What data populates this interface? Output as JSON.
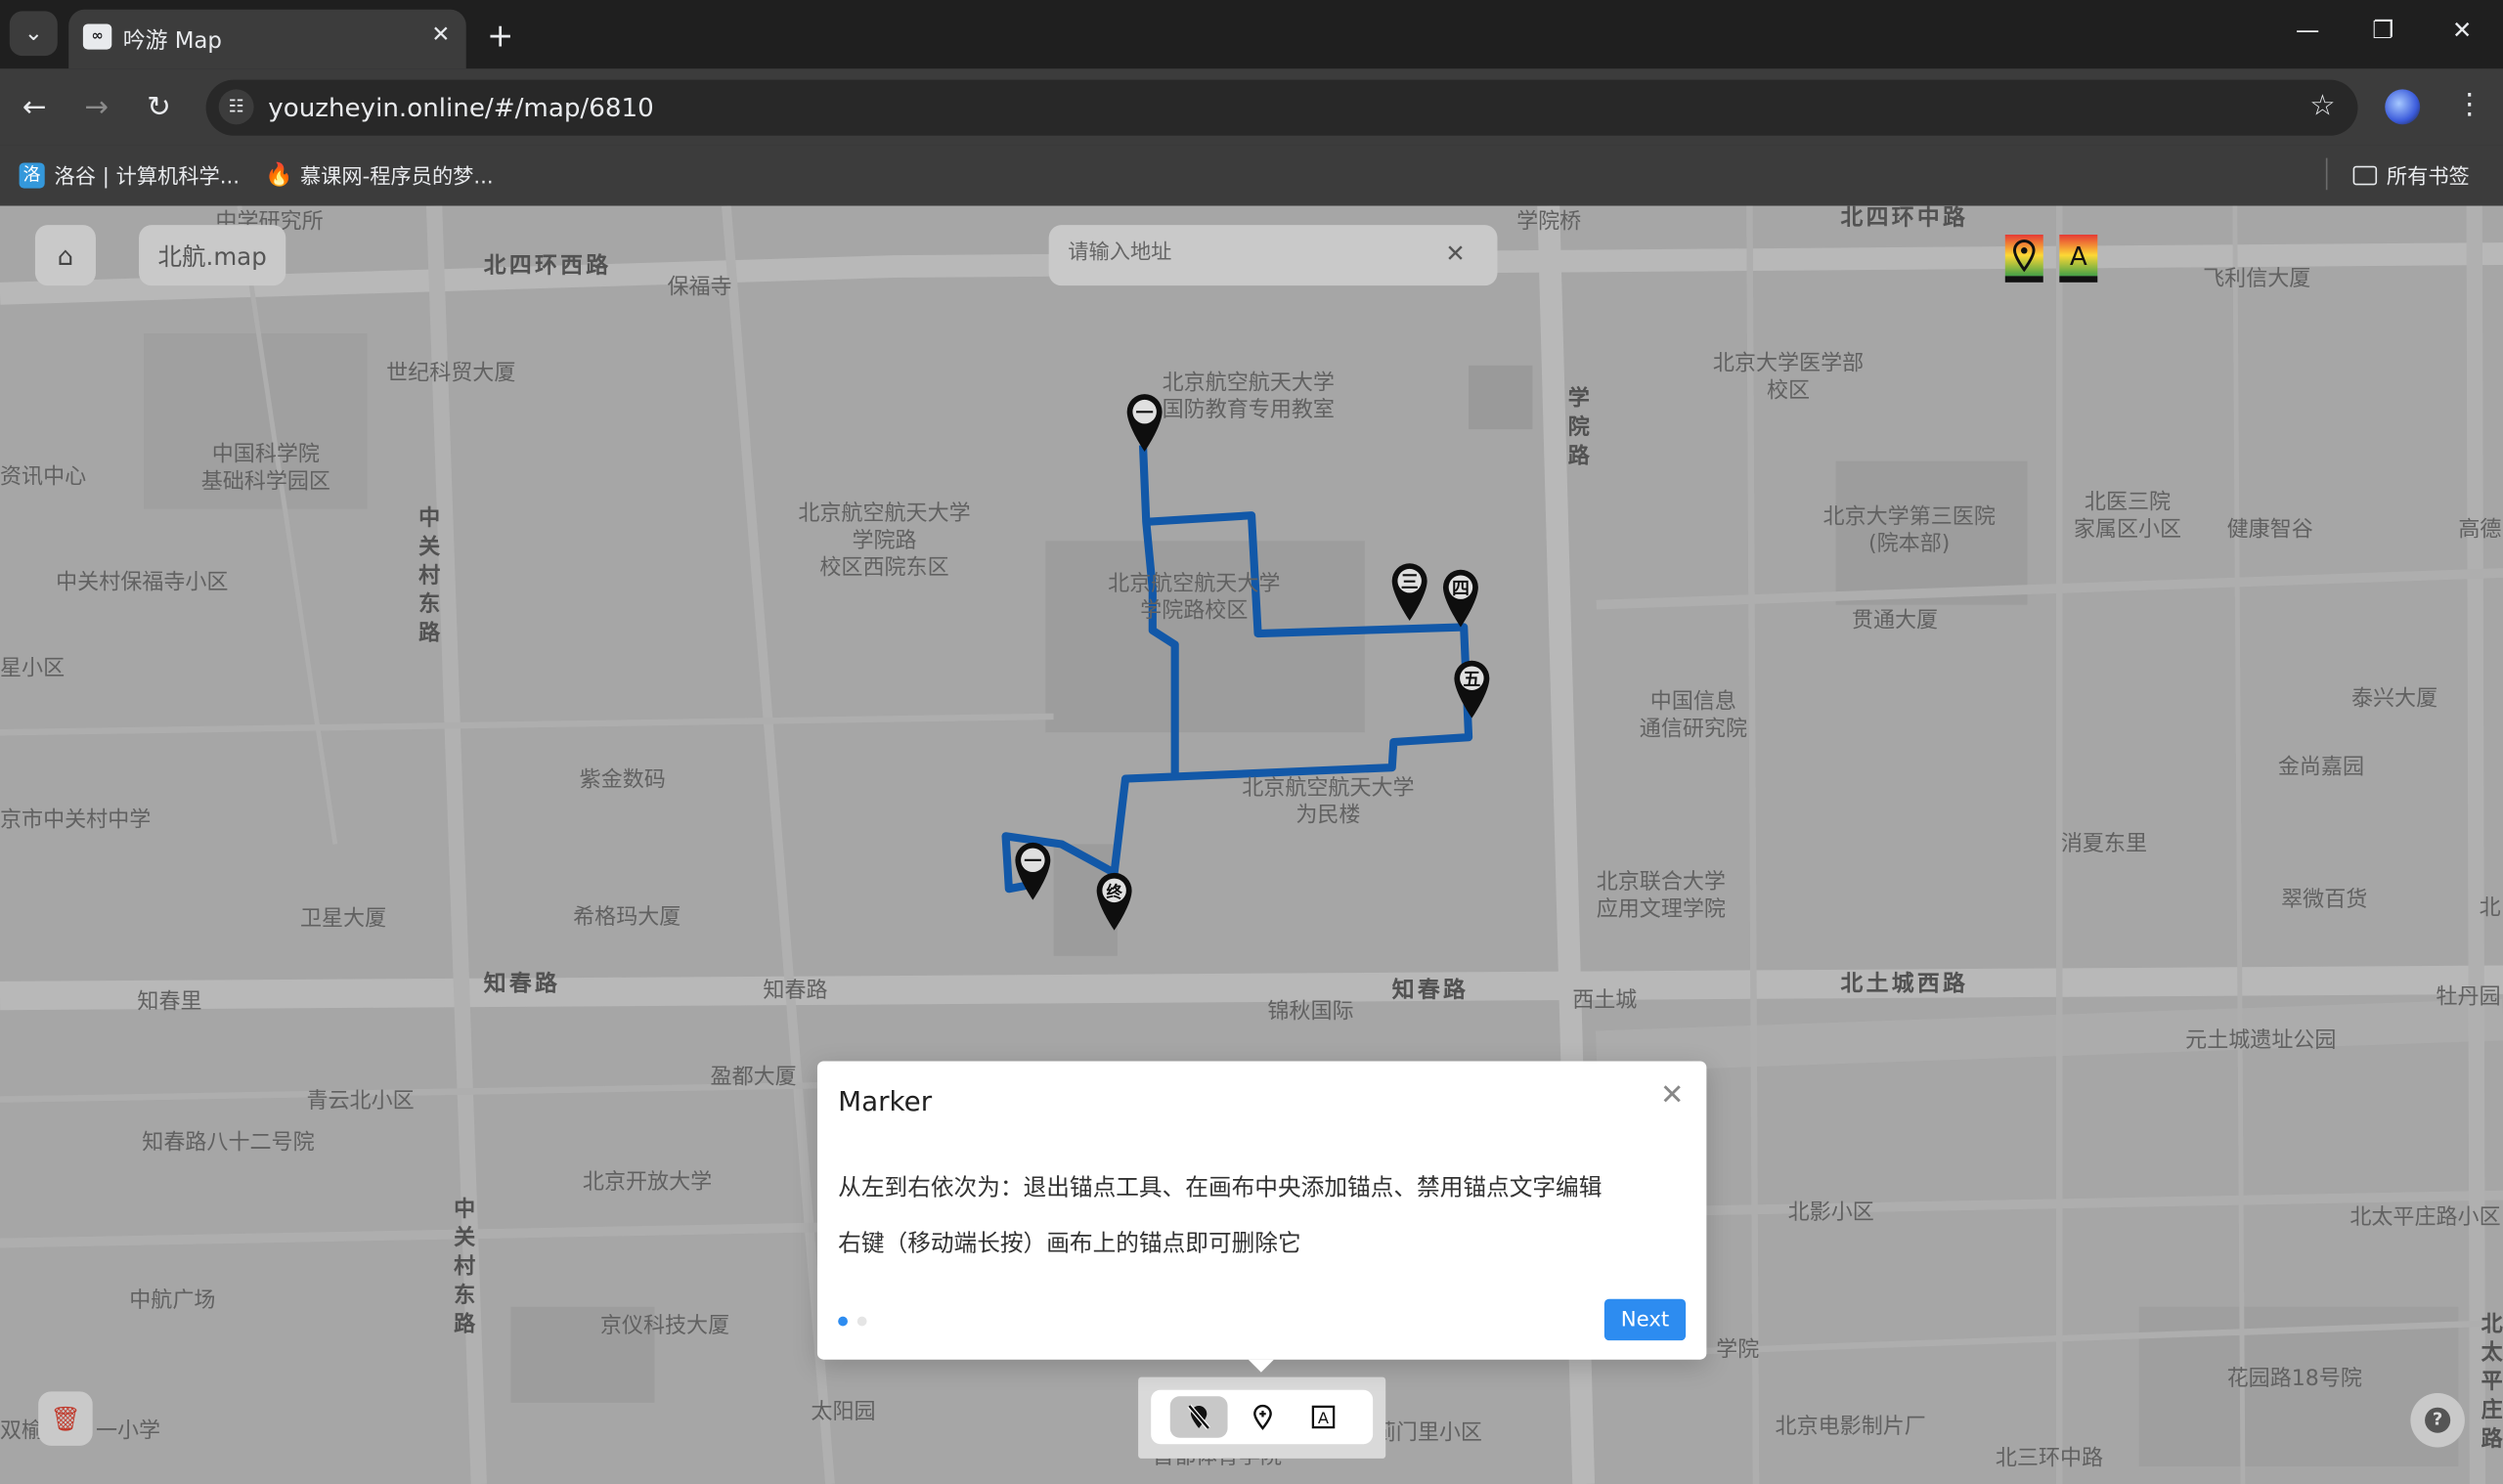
{
  "browser": {
    "tab_title": "吟游 Map",
    "url": "youzheyin.online/#/map/6810",
    "bookmarks": [
      {
        "label": "洛谷 | 计算机科学..."
      },
      {
        "label": "慕课网-程序员的梦..."
      }
    ],
    "all_bookmarks": "所有书签"
  },
  "app": {
    "map_title": "北航.map",
    "search_placeholder": "请输入地址",
    "layer_label_a": "A"
  },
  "map": {
    "labels": [
      {
        "text": "北四环西路",
        "road": true
      },
      {
        "text": "北四环中路",
        "road": true
      },
      {
        "text": "知春路",
        "road": true
      },
      {
        "text": "知春路",
        "road": true
      },
      {
        "text": "北土城西路",
        "road": true
      },
      {
        "text": "中关村东路",
        "road": true
      },
      {
        "text": "中关村东路",
        "road": true
      },
      {
        "text": "学院路",
        "road": true
      },
      {
        "text": "保福寺"
      },
      {
        "text": "学院桥"
      },
      {
        "text": "飞利信大厦"
      },
      {
        "text": "世纪科贸大厦"
      },
      {
        "text": "北京航空航天大学\n国防教育专用教室"
      },
      {
        "text": "北京大学医学部\n校区"
      },
      {
        "text": "中国科学院\n基础科学园区"
      },
      {
        "text": "资讯中心"
      },
      {
        "text": "北京航空航天大学\n学院路\n校区西院东区"
      },
      {
        "text": "北京大学第三医院\n(院本部)"
      },
      {
        "text": "北医三院\n家属区小区"
      },
      {
        "text": "健康智谷"
      },
      {
        "text": "高德"
      },
      {
        "text": "中关村保福寺小区"
      },
      {
        "text": "北京航空航天大学\n学院路校区"
      },
      {
        "text": "贯通大厦"
      },
      {
        "text": "星小区"
      },
      {
        "text": "中国信息\n通信研究院"
      },
      {
        "text": "泰兴大厦"
      },
      {
        "text": "紫金数码"
      },
      {
        "text": "北京航空航天大学\n为民楼"
      },
      {
        "text": "金尚嘉园"
      },
      {
        "text": "京市中关村中学"
      },
      {
        "text": "消夏东里"
      },
      {
        "text": "北京联合大学\n应用文理学院"
      },
      {
        "text": "翠微百货"
      },
      {
        "text": "卫星大厦"
      },
      {
        "text": "希格玛大厦"
      },
      {
        "text": "知春里"
      },
      {
        "text": "知春路"
      },
      {
        "text": "锦秋国际"
      },
      {
        "text": "西土城"
      },
      {
        "text": "牡丹园"
      },
      {
        "text": "元土城遗址公园"
      },
      {
        "text": "盈都大厦"
      },
      {
        "text": "青云北小区"
      },
      {
        "text": "知春路八十二号院"
      },
      {
        "text": "北京开放大学"
      },
      {
        "text": "北影小区"
      },
      {
        "text": "北太平庄路小区"
      },
      {
        "text": "中航广场"
      },
      {
        "text": "京仪科技大厦"
      },
      {
        "text": "学院"
      },
      {
        "text": "花园路18号院"
      },
      {
        "text": "太阳园"
      },
      {
        "text": "蓟门里小区"
      },
      {
        "text": "北京电影制片厂"
      },
      {
        "text": "一小学"
      },
      {
        "text": "双榆"
      },
      {
        "text": "首都体育学院"
      },
      {
        "text": "北三环中路"
      },
      {
        "text": "中学研究所"
      },
      {
        "text": "北太平庄路"
      },
      {
        "text": "北"
      }
    ],
    "markers": [
      {
        "glyph": "一"
      },
      {
        "glyph": "三"
      },
      {
        "glyph": "四"
      },
      {
        "glyph": "五"
      },
      {
        "glyph": "一"
      },
      {
        "glyph": "终"
      }
    ]
  },
  "tour": {
    "title": "Marker",
    "line1": "从左到右依次为：退出锚点工具、在画布中央添加锚点、禁用锚点文字编辑",
    "line2": "右键（移动端长按）画布上的锚点即可删除它",
    "next_label": "Next",
    "step": 1,
    "total_steps": 2
  },
  "toolbar": {
    "text_tool_glyph": "A"
  },
  "colors": {
    "route": "#1565c0",
    "accent": "#2d8cf0",
    "map_bg": "#bdbdbd"
  }
}
